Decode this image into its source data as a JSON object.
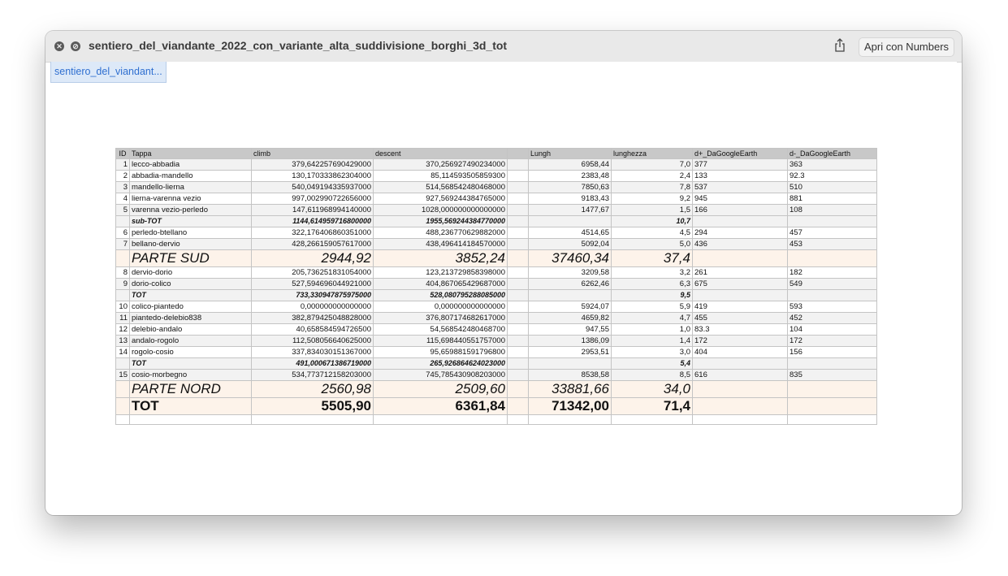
{
  "window": {
    "title": "sentiero_del_viandante_2022_con_variante_alta_suddivisione_borghi_3d_tot",
    "open_button": "Apri con Numbers",
    "close_icon": "close-icon",
    "block_icon": "block-icon",
    "share_icon": "share-icon"
  },
  "sheet_tab": "sentiero_del_viandant...",
  "table": {
    "headers": [
      "ID",
      "Tappa",
      "climb",
      "descent",
      "",
      "Lungh",
      "lunghezza",
      "d+_DaGoogleEarth",
      "d-_DaGoogleEarth"
    ],
    "rows": [
      {
        "type": "data",
        "cells": [
          "1",
          "lecco-abbadia",
          "379,642257690429000",
          "370,256927490234000",
          "",
          "6958,44",
          "7,0",
          "377",
          "363"
        ]
      },
      {
        "type": "data",
        "cells": [
          "2",
          "abbadia-mandello",
          "130,170333862304000",
          "85,114593505859300",
          "",
          "2383,48",
          "2,4",
          "133",
          "92.3"
        ]
      },
      {
        "type": "data",
        "cells": [
          "3",
          "mandello-lierna",
          "540,049194335937000",
          "514,568542480468000",
          "",
          "7850,63",
          "7,8",
          "537",
          "510"
        ]
      },
      {
        "type": "data",
        "cells": [
          "4",
          "lierna-varenna vezio",
          "997,002990722656000",
          "927,569244384765000",
          "",
          "9183,43",
          "9,2",
          "945",
          "881"
        ]
      },
      {
        "type": "data",
        "cells": [
          "5",
          "varenna vezio-perledo",
          "147,611968994140000",
          "1028,000000000000000",
          "",
          "1477,67",
          "1,5",
          "166",
          "108"
        ]
      },
      {
        "type": "sub",
        "cells": [
          "",
          "sub-TOT",
          "1144,614959716800000",
          "1955,569244384770000",
          "",
          "",
          "10,7",
          "",
          ""
        ]
      },
      {
        "type": "data",
        "cells": [
          "6",
          "perledo-btellano",
          "322,176406860351000",
          "488,236770629882000",
          "",
          "4514,65",
          "4,5",
          "294",
          "457"
        ]
      },
      {
        "type": "data",
        "cells": [
          "7",
          "bellano-dervio",
          "428,266159057617000",
          "438,496414184570000",
          "",
          "5092,04",
          "5,0",
          "436",
          "453"
        ]
      },
      {
        "type": "big",
        "cells": [
          "",
          "PARTE SUD",
          "2944,92",
          "3852,24",
          "",
          "37460,34",
          "37,4",
          "",
          ""
        ]
      },
      {
        "type": "data",
        "cells": [
          "8",
          "dervio-dorio",
          "205,736251831054000",
          "123,213729858398000",
          "",
          "3209,58",
          "3,2",
          "261",
          "182"
        ]
      },
      {
        "type": "data",
        "cells": [
          "9",
          "dorio-colico",
          "527,594696044921000",
          "404,867065429687000",
          "",
          "6262,46",
          "6,3",
          "675",
          "549"
        ]
      },
      {
        "type": "sub",
        "cells": [
          "",
          "TOT",
          "733,330947875975000",
          "528,080795288085000",
          "",
          "",
          "9,5",
          "",
          ""
        ]
      },
      {
        "type": "data",
        "cells": [
          "10",
          "colico-piantedo",
          "0,000000000000000",
          "0,000000000000000",
          "",
          "5924,07",
          "5,9",
          "419",
          "593"
        ]
      },
      {
        "type": "data",
        "cells": [
          "11",
          "piantedo-delebio838",
          "382,879425048828000",
          "376,807174682617000",
          "",
          "4659,82",
          "4,7",
          "455",
          "452"
        ]
      },
      {
        "type": "data",
        "cells": [
          "12",
          "delebio-andalo",
          "40,658584594726500",
          "54,568542480468700",
          "",
          "947,55",
          "1,0",
          "83.3",
          "104"
        ]
      },
      {
        "type": "data",
        "cells": [
          "13",
          "andalo-rogolo",
          "112,508056640625000",
          "115,698440551757000",
          "",
          "1386,09",
          "1,4",
          "172",
          "172"
        ]
      },
      {
        "type": "data",
        "cells": [
          "14",
          "rogolo-cosio",
          "337,834030151367000",
          "95,659881591796800",
          "",
          "2953,51",
          "3,0",
          "404",
          "156"
        ]
      },
      {
        "type": "sub",
        "cells": [
          "",
          "TOT",
          "491,000671386719000",
          "265,926864624023000",
          "",
          "",
          "5,4",
          "",
          ""
        ]
      },
      {
        "type": "data",
        "cells": [
          "15",
          "cosio-morbegno",
          "534,773712158203000",
          "745,785430908203000",
          "",
          "8538,58",
          "8,5",
          "616",
          "835"
        ]
      },
      {
        "type": "big",
        "cells": [
          "",
          "PARTE NORD",
          "2560,98",
          "2509,60",
          "",
          "33881,66",
          "34,0",
          "",
          ""
        ]
      },
      {
        "type": "bigb",
        "cells": [
          "",
          "TOT",
          "5505,90",
          "6361,84",
          "",
          "71342,00",
          "71,4",
          "",
          ""
        ]
      },
      {
        "type": "empty",
        "cells": [
          "",
          "",
          "",
          "",
          "",
          "",
          "",
          "",
          ""
        ]
      }
    ]
  }
}
